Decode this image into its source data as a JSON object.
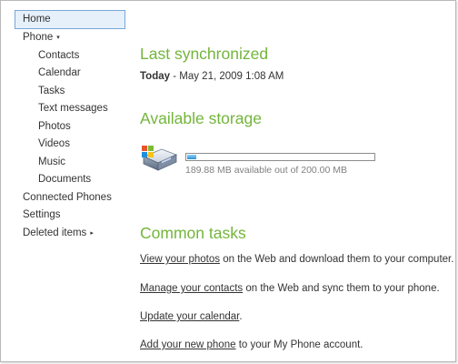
{
  "sidebar": {
    "items": [
      {
        "label": "Home"
      },
      {
        "label": "Phone"
      },
      {
        "label": "Contacts"
      },
      {
        "label": "Calendar"
      },
      {
        "label": "Tasks"
      },
      {
        "label": "Text messages"
      },
      {
        "label": "Photos"
      },
      {
        "label": "Videos"
      },
      {
        "label": "Music"
      },
      {
        "label": "Documents"
      },
      {
        "label": "Connected Phones"
      },
      {
        "label": "Settings"
      },
      {
        "label": "Deleted items"
      }
    ],
    "phone_caret": "▾",
    "deleted_caret": "▸"
  },
  "sync": {
    "heading": "Last synchronized",
    "day": "Today",
    "separator": " - ",
    "datetime": "May 21, 2009 1:08 AM"
  },
  "storage": {
    "heading": "Available storage",
    "summary": "189.88 MB available out of 200.00 MB",
    "used_fraction": 0.0506,
    "icon": "storage-device-icon"
  },
  "tasks": {
    "heading": "Common tasks",
    "items": [
      {
        "link": "View your photos",
        "rest": " on the Web and download them to your computer."
      },
      {
        "link": "Manage your contacts",
        "rest": " on the Web and sync them to your phone."
      },
      {
        "link": "Update your calendar",
        "rest": "."
      },
      {
        "link": "Add your new phone",
        "rest": " to your My Phone account."
      }
    ]
  },
  "colors": {
    "accent_green": "#73b53b",
    "selection_border": "#7aa7d9",
    "selection_fill": "#e6f0fb"
  }
}
